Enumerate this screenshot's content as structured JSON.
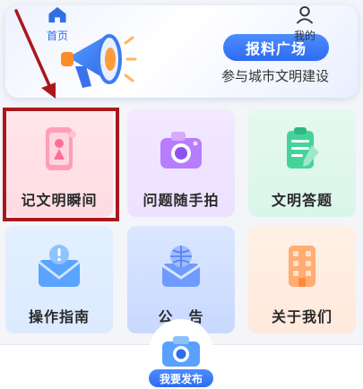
{
  "banner": {
    "button_label": "报料广场",
    "subtitle": "参与城市文明建设",
    "icon": "megaphone-icon"
  },
  "tiles": [
    {
      "label": "记文明瞬间",
      "icon": "phone-capture-icon",
      "bg": "#ffe2e8"
    },
    {
      "label": "问题随手拍",
      "icon": "camera-icon",
      "bg": "#efe4ff"
    },
    {
      "label": "文明答题",
      "icon": "clipboard-pen-icon",
      "bg": "#def7ec"
    },
    {
      "label": "操作指南",
      "icon": "envelope-alert-icon",
      "bg": "#e0edff"
    },
    {
      "label": "公　告",
      "icon": "globe-envelope-icon",
      "bg": "#d2e0ff"
    },
    {
      "label": "关于我们",
      "icon": "building-icon",
      "bg": "#ffece0"
    }
  ],
  "nav": {
    "home_label": "首页",
    "publish_label": "我要发布",
    "mine_label": "我的",
    "accent": "#2f6fe6"
  },
  "annotation": {
    "highlight_color": "#a8191d"
  }
}
